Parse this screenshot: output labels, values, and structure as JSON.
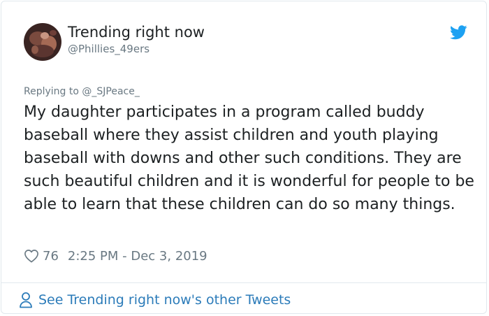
{
  "tweet": {
    "author_name": "Trending right now",
    "author_handle": "@Phillies_49ers",
    "reply_context": "Replying to @_SJPeace_",
    "text": "My daughter participates in a program called buddy baseball where they assist children and youth playing baseball with downs and other such conditions. They are such beautiful children and it is wonderful for people to be able to learn that these children can do so many things.",
    "like_count": "76",
    "timestamp": "2:25 PM - Dec 3, 2019"
  },
  "footer": {
    "link_label": "See Trending right now's other Tweets"
  },
  "icons": {
    "brand": "twitter-bird-icon",
    "like": "heart-icon",
    "profile": "person-icon"
  },
  "colors": {
    "brand_blue": "#1da1f2",
    "link_blue": "#2b7bb9",
    "secondary_text": "#697882",
    "border": "#e1e8ed"
  }
}
